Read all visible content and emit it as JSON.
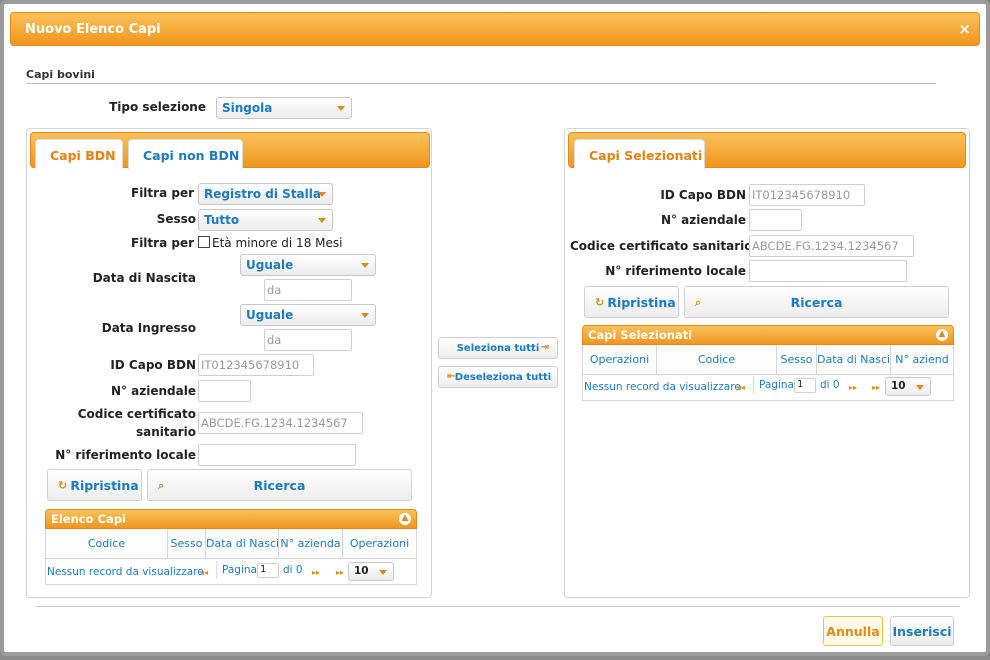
{
  "dialog": {
    "title": "Nuovo Elenco Capi",
    "close_glyph": "×"
  },
  "section": {
    "legend": "Capi bovini"
  },
  "tipo_selezione": {
    "label": "Tipo selezione",
    "value": "Singola"
  },
  "left": {
    "tabs": [
      {
        "label": "Capi BDN",
        "active": true
      },
      {
        "label": "Capi non BDN",
        "active": false
      }
    ],
    "filtra_per_label": "Filtra per",
    "filtra_per_value": "Registro di Stalla",
    "sesso_label": "Sesso",
    "sesso_value": "Tutto",
    "filtra_per2_label": "Filtra per",
    "eta_checkbox_label": "Età minore di 18 Mesi",
    "data_nascita_label": "Data di Nascita",
    "data_nascita_op": "Uguale",
    "data_nascita_placeholder": "da",
    "data_ingresso_label": "Data Ingresso",
    "data_ingresso_op": "Uguale",
    "data_ingresso_placeholder": "da",
    "id_capo_label": "ID Capo BDN",
    "id_capo_placeholder": "IT012345678910",
    "n_aziendale_label": "N° aziendale",
    "codice_cert_label_1": "Codice certificato",
    "codice_cert_label_2": "sanitario",
    "codice_cert_placeholder": "ABCDE.FG.1234.1234567",
    "n_rif_label": "N° riferimento locale",
    "ripristina_label": "Ripristina",
    "ricerca_label": "Ricerca",
    "grid": {
      "title": "Elenco Capi",
      "columns": [
        "Codice",
        "Sesso",
        "Data di Nasci",
        "N° azienda",
        "Operazioni"
      ],
      "empty_text": "Nessun record da visualizzare",
      "page_label": "Pagina",
      "page_value": "1",
      "of_label": "di 0",
      "page_size": "10"
    }
  },
  "middle": {
    "select_all_label": "Seleziona tutti",
    "deselect_all_label": "Deseleziona tutti"
  },
  "right": {
    "tab_label": "Capi Selezionati",
    "id_capo_label": "ID Capo BDN",
    "id_capo_placeholder": "IT012345678910",
    "n_aziendale_label": "N° aziendale",
    "codice_cert_label": "Codice certificato sanitario",
    "codice_cert_placeholder": "ABCDE.FG.1234.1234567",
    "n_rif_label": "N° riferimento locale",
    "ripristina_label": "Ripristina",
    "ricerca_label": "Ricerca",
    "grid": {
      "title": "Capi Selezionati",
      "columns": [
        "Operazioni",
        "Codice",
        "Sesso",
        "Data di Nasci",
        "N° aziend"
      ],
      "empty_text": "Nessun record da visualizzare",
      "page_label": "Pagina",
      "page_value": "1",
      "of_label": "di 0",
      "page_size": "10"
    }
  },
  "footer": {
    "cancel_label": "Annulla",
    "insert_label": "Inserisci"
  },
  "colors": {
    "accent": "#f0951f",
    "link": "#1a7bbf"
  }
}
